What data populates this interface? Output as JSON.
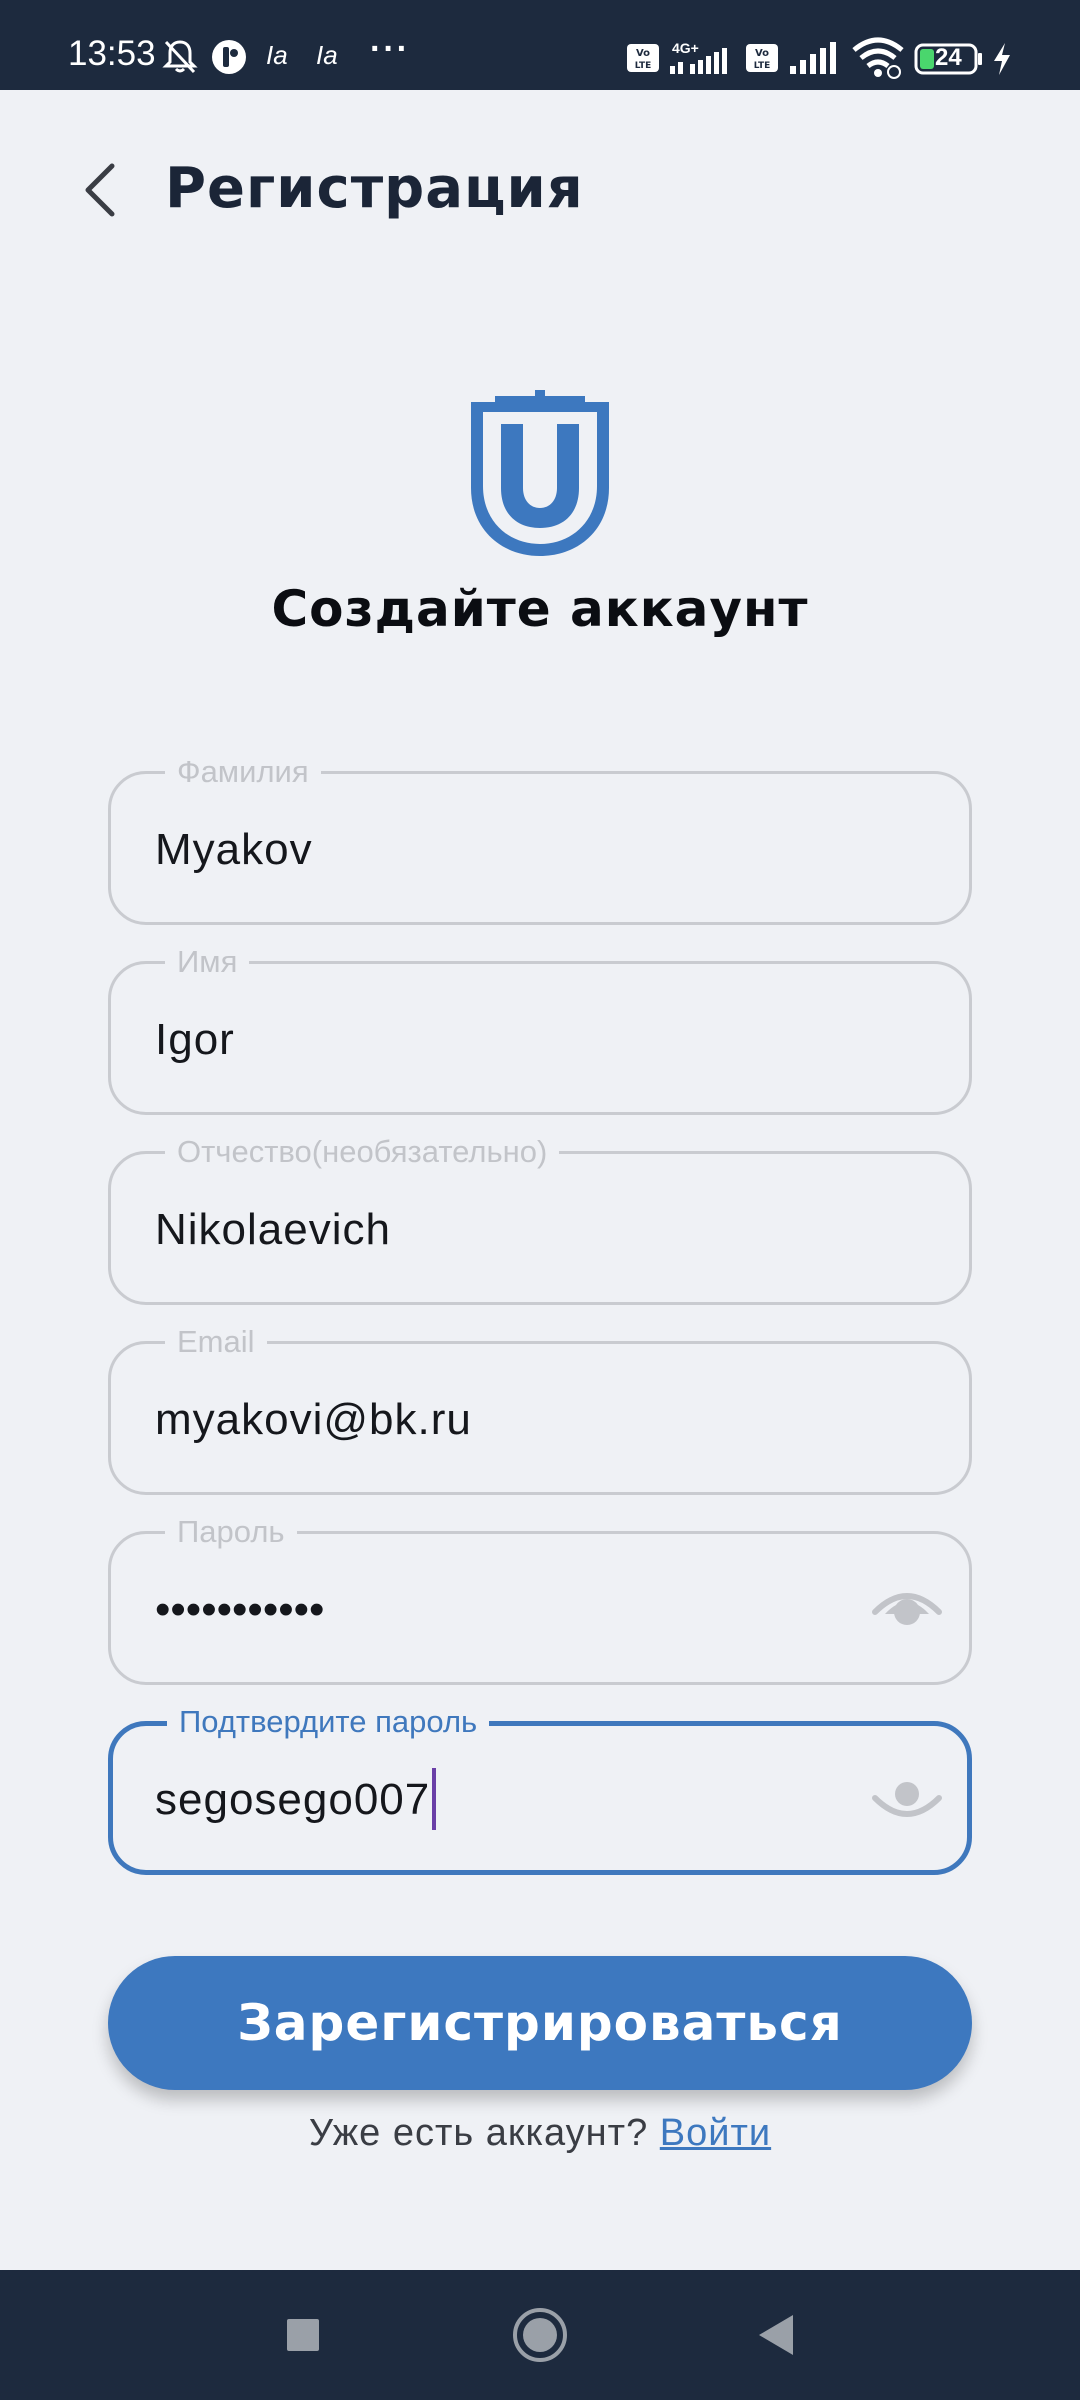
{
  "status_bar": {
    "time": "13:53",
    "indicators": [
      "Ia",
      "Ia"
    ],
    "more": "···",
    "network1": "4G+",
    "volte": "Vo LTE",
    "battery_level": "24",
    "icons": [
      "bell-off-icon",
      "app-notification-icon",
      "volte-icon",
      "signal-icon",
      "wifi-icon",
      "battery-icon",
      "charging-icon"
    ]
  },
  "header": {
    "title": "Регистрация",
    "back_icon": "chevron-left-icon"
  },
  "logo": {
    "letter": "U",
    "brand_color": "#3d78bf"
  },
  "subtitle": "Создайте аккаунт",
  "form": {
    "fields": [
      {
        "label": "Фамилия",
        "value": "Myakov"
      },
      {
        "label": "Имя",
        "value": "Igor"
      },
      {
        "label": "Отчество(необязательно)",
        "value": "Nikolaevich"
      },
      {
        "label": "Email",
        "value": "myakovi@bk.ru"
      },
      {
        "label": "Пароль",
        "value": "•••••••••••"
      },
      {
        "label": "Подтвердите пароль",
        "value": "segosego007"
      }
    ],
    "submit_label": "Зарегистрироваться",
    "login_prompt": "Уже есть аккаунт?",
    "login_link": "Войти"
  },
  "colors": {
    "accent": "#3d78bf",
    "background": "#eff1f5",
    "bars": "#1d2a3e",
    "title": "#1b2537"
  },
  "nav": {
    "icons": [
      "recents-square-icon",
      "home-circle-icon",
      "back-triangle-icon"
    ]
  }
}
